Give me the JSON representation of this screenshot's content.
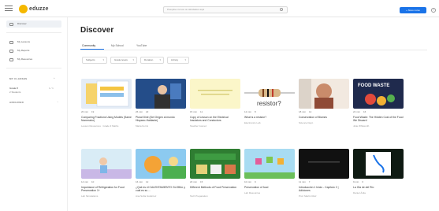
{
  "topbar": {
    "logo_text": "eduzze",
    "search_placeholder": "Pesquise cursos ou atividades aqui",
    "new_button": "+ Novo curso",
    "help": "?"
  },
  "sidebar": {
    "items": [
      {
        "label": "Discover"
      },
      {
        "label": "My Lessons"
      },
      {
        "label": "My Reports"
      },
      {
        "label": "My Resources"
      }
    ],
    "classes_header": "MY CLASSES",
    "classes_add": "+",
    "class_name": "Grade 8",
    "class_sub": "2 Students",
    "class_count": "1 / 1",
    "archived_header": "ARCHIVED"
  },
  "main": {
    "title": "Discover",
    "tabs": [
      "Community",
      "My School",
      "YouTube"
    ],
    "filters": [
      "Subjects",
      "Grade levels",
      "Duration",
      "Library"
    ],
    "cards": [
      {
        "title": "Comparing Fractions Using Models (Same Numerator)",
        "author": "Lesson Resources · Grade 3 Maths",
        "duration": "20 min",
        "slides": "19",
        "theme": "fractions"
      },
      {
        "title": "Plural Diné (Del Origen al mundo Hispano-Hablante)",
        "author": "Maria Fermi",
        "duration": "26 min",
        "slides": "22",
        "theme": "speaker"
      },
      {
        "title": "Copy of Lesson on the Electrical Insulators and Conductors",
        "author": "Teacher Gomez",
        "duration": "15 min",
        "slides": "11",
        "theme": "paper"
      },
      {
        "title": "What is a resistor?",
        "author": "Electronics Lab",
        "duration": "12 min",
        "slides": "8",
        "theme": "resistor"
      },
      {
        "title": "Conservation of Biomes",
        "author": "Science Dept.",
        "duration": "18 min",
        "slides": "14",
        "theme": "biome"
      },
      {
        "title": "Food Waste: The Hidden Cost of the Food We Discard",
        "author": "Julie Whitworth",
        "duration": "22 min",
        "slides": "16",
        "theme": "foodwaste"
      },
      {
        "title": "Importance of Refrigeration for Food Preservation 1+",
        "author": "Lab Simulations",
        "duration": "14 min",
        "slides": "10",
        "theme": "kitchen"
      },
      {
        "title": "¿Qué es el CALENTAMIENTO GLOBAL y cuál es su ...",
        "author": "Ana Sofía Gutiérrez",
        "duration": "16 min",
        "slides": "12",
        "theme": "globe"
      },
      {
        "title": "Different Methods of Food Preservation",
        "author": "Tech Preparation",
        "duration": "20 min",
        "slides": "15",
        "theme": "methods"
      },
      {
        "title": "Preservation of food",
        "author": "Lab Resources",
        "duration": "10 min",
        "slides": "9",
        "theme": "pixel"
      },
      {
        "title": "Introducción 1 Inicio - Capítulo 2 | Adiciones",
        "author": "Prof. Martín Ruiz",
        "duration": "11 min",
        "slides": "7",
        "theme": "dark"
      },
      {
        "title": "La Ola de del Río",
        "author": "Daniel Ávila",
        "duration": "9 min",
        "slides": "6",
        "theme": "wave"
      }
    ]
  },
  "colors": {
    "accent": "#1a73e8",
    "logo": "#f5b800"
  }
}
